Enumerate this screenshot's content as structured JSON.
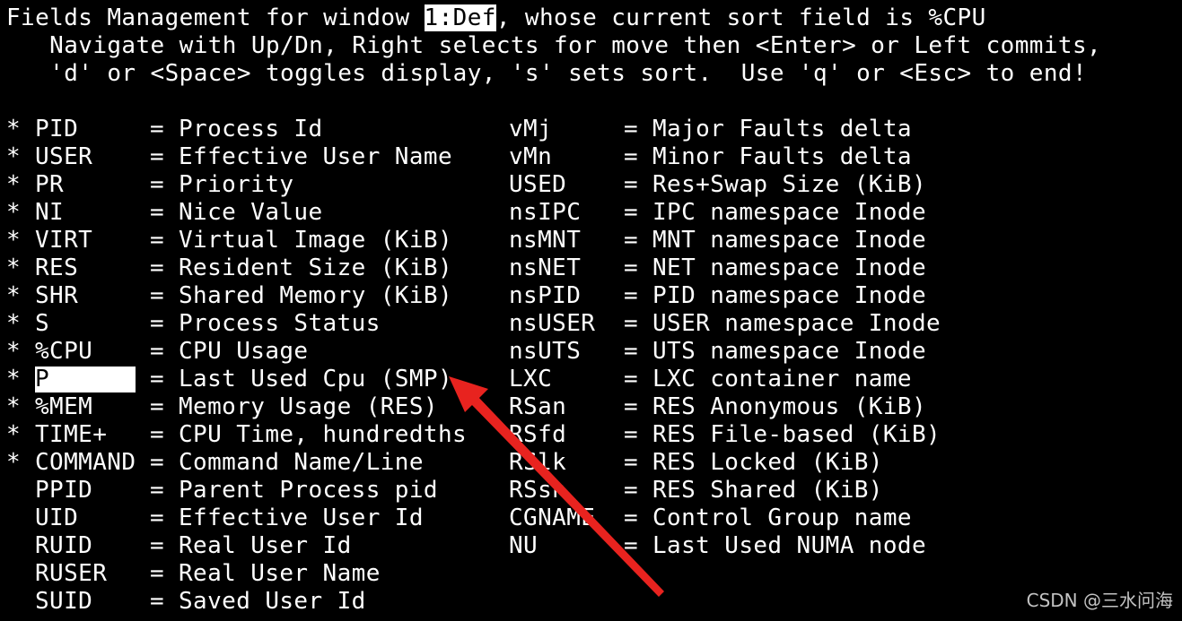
{
  "header": {
    "line1_prefix": "Fields Management for window ",
    "window_name": "1:Def",
    "line1_suffix": ", whose current sort field is %CPU",
    "line2": "   Navigate with Up/Dn, Right selects for move then <Enter> or Left commits,",
    "line3": "   'd' or <Space> toggles display, 's' sets sort.  Use 'q' or <Esc> to end!"
  },
  "fields": [
    {
      "star": "*",
      "name": "PID",
      "desc": "Process Id",
      "name2": "vMj",
      "desc2": "Major Faults delta"
    },
    {
      "star": "*",
      "name": "USER",
      "desc": "Effective User Name",
      "name2": "vMn",
      "desc2": "Minor Faults delta"
    },
    {
      "star": "*",
      "name": "PR",
      "desc": "Priority",
      "name2": "USED",
      "desc2": "Res+Swap Size (KiB)"
    },
    {
      "star": "*",
      "name": "NI",
      "desc": "Nice Value",
      "name2": "nsIPC",
      "desc2": "IPC namespace Inode"
    },
    {
      "star": "*",
      "name": "VIRT",
      "desc": "Virtual Image (KiB)",
      "name2": "nsMNT",
      "desc2": "MNT namespace Inode"
    },
    {
      "star": "*",
      "name": "RES",
      "desc": "Resident Size (KiB)",
      "name2": "nsNET",
      "desc2": "NET namespace Inode"
    },
    {
      "star": "*",
      "name": "SHR",
      "desc": "Shared Memory (KiB)",
      "name2": "nsPID",
      "desc2": "PID namespace Inode"
    },
    {
      "star": "*",
      "name": "S",
      "desc": "Process Status",
      "name2": "nsUSER",
      "desc2": "USER namespace Inode"
    },
    {
      "star": "*",
      "name": "%CPU",
      "desc": "CPU Usage",
      "name2": "nsUTS",
      "desc2": "UTS namespace Inode"
    },
    {
      "star": "*",
      "name": "P",
      "desc": "Last Used Cpu (SMP)",
      "name2": "LXC",
      "desc2": "LXC container name",
      "selected": true
    },
    {
      "star": "*",
      "name": "%MEM",
      "desc": "Memory Usage (RES)",
      "name2": "RSan",
      "desc2": "RES Anonymous (KiB)"
    },
    {
      "star": "*",
      "name": "TIME+",
      "desc": "CPU Time, hundredths",
      "name2": "RSfd",
      "desc2": "RES File-based (KiB)"
    },
    {
      "star": "*",
      "name": "COMMAND",
      "desc": "Command Name/Line",
      "name2": "RSlk",
      "desc2": "RES Locked (KiB)"
    },
    {
      "star": "",
      "name": "PPID",
      "desc": "Parent Process pid",
      "name2": "RSsh",
      "desc2": "RES Shared (KiB)"
    },
    {
      "star": "",
      "name": "UID",
      "desc": "Effective User Id",
      "name2": "CGNAME",
      "desc2": "Control Group name"
    },
    {
      "star": "",
      "name": "RUID",
      "desc": "Real User Id",
      "name2": "NU",
      "desc2": "Last Used NUMA node"
    },
    {
      "star": "",
      "name": "RUSER",
      "desc": "Real User Name",
      "name2": "",
      "desc2": ""
    },
    {
      "star": "",
      "name": "SUID",
      "desc": "Saved User Id",
      "name2": "",
      "desc2": ""
    }
  ],
  "equals": "=",
  "watermark": "CSDN @三水问海",
  "colors": {
    "background": "#000000",
    "text": "#ffffff",
    "highlight_bg": "#ffffff",
    "arrow": "#e8231f"
  }
}
